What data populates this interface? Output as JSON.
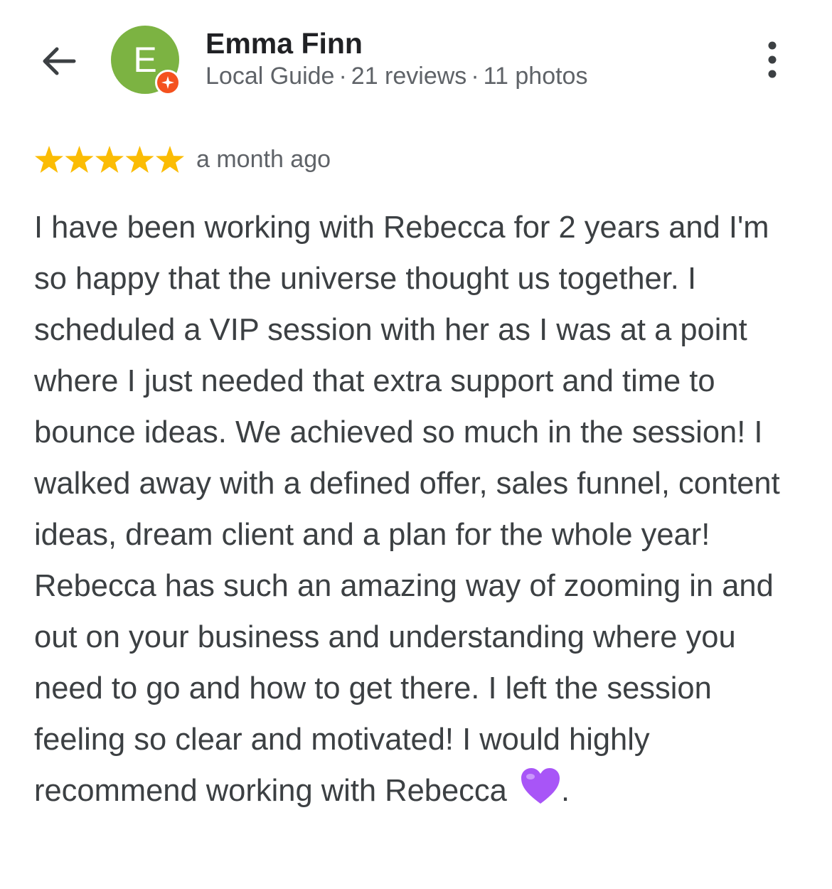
{
  "reviewer": {
    "name": "Emma Finn",
    "avatar_letter": "E",
    "avatar_color": "#7cb342",
    "badge": "local-guide-badge-icon",
    "level": "Local Guide",
    "reviews": "21 reviews",
    "photos": "11 photos",
    "separator": "·"
  },
  "review": {
    "rating": 5,
    "rating_max": 5,
    "star_color": "#fbbc04",
    "time": "a month ago",
    "text": "I have been working with Rebecca for 2 years and I'm so happy that the universe thought us together. I scheduled a VIP session with her as I was at a point where I just needed that extra support and time to bounce ideas. We achieved so much in the session! I walked away with a defined offer, sales funnel, content ideas, dream client and a plan for the whole year! Rebecca has such an amazing way of zooming in and out on your business and understanding where you need to go and how to get there. I left the session feeling so clear and motivated! I would highly recommend working with Rebecca",
    "emoji": "purple-heart-icon",
    "text_end": "."
  },
  "icons": {
    "back": "arrow-back-icon",
    "more": "more-vert-icon"
  },
  "colors": {
    "heart": "#a855f7",
    "badge": "#f4511e"
  }
}
